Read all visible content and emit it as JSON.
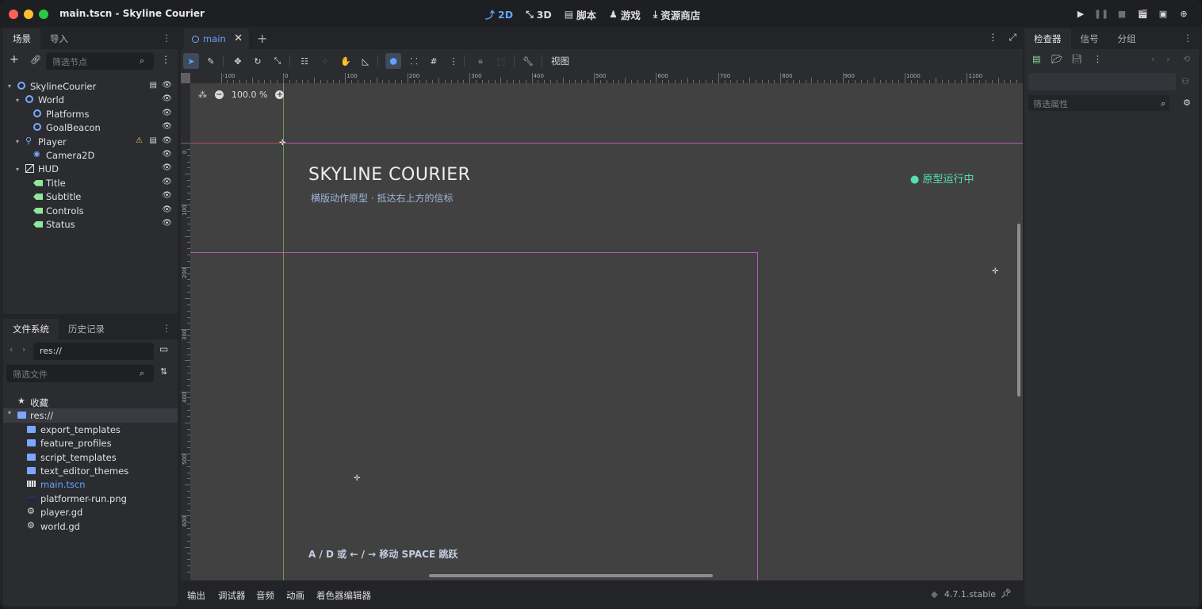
{
  "window": {
    "title": "main.tscn - Skyline Courier"
  },
  "modes": [
    {
      "icon": "2d-icon",
      "label": "2D",
      "active": true
    },
    {
      "icon": "3d-icon",
      "label": "3D",
      "active": false
    },
    {
      "icon": "script-icon",
      "label": "脚本",
      "active": false
    },
    {
      "icon": "game-icon",
      "label": "游戏",
      "active": false
    },
    {
      "icon": "asset-library-icon",
      "label": "资源商店",
      "active": false
    }
  ],
  "scene_dock": {
    "tabs": [
      "场景",
      "导入"
    ],
    "filter_placeholder": "筛选节点",
    "nodes": [
      {
        "label": "SkylineCourier",
        "icon": "node2d-icon",
        "depth": 0,
        "expanded": true,
        "script": true
      },
      {
        "label": "World",
        "icon": "node2d-icon",
        "depth": 1,
        "expanded": true
      },
      {
        "label": "Platforms",
        "icon": "node2d-icon",
        "depth": 2
      },
      {
        "label": "GoalBeacon",
        "icon": "node2d-icon",
        "depth": 2
      },
      {
        "label": "Player",
        "icon": "character-body-icon",
        "depth": 1,
        "expanded": true,
        "script": true,
        "warning": true
      },
      {
        "label": "Camera2D",
        "icon": "camera-icon",
        "depth": 2
      },
      {
        "label": "HUD",
        "icon": "canvas-layer-icon",
        "depth": 1,
        "expanded": true
      },
      {
        "label": "Title",
        "icon": "label-icon",
        "depth": 2
      },
      {
        "label": "Subtitle",
        "icon": "label-icon",
        "depth": 2
      },
      {
        "label": "Controls",
        "icon": "label-icon",
        "depth": 2
      },
      {
        "label": "Status",
        "icon": "label-icon",
        "depth": 2
      }
    ]
  },
  "filesystem_dock": {
    "tabs": [
      "文件系统",
      "历史记录"
    ],
    "path": "res://",
    "filter_placeholder": "筛选文件",
    "favorites_label": "收藏",
    "root_label": "res://",
    "items": [
      {
        "label": "export_templates",
        "icon": "folder-icon"
      },
      {
        "label": "feature_profiles",
        "icon": "folder-icon"
      },
      {
        "label": "script_templates",
        "icon": "folder-icon"
      },
      {
        "label": "text_editor_themes",
        "icon": "folder-icon"
      },
      {
        "label": "main.tscn",
        "icon": "scene-file-icon"
      },
      {
        "label": "platformer-run.png",
        "icon": "image-file-icon"
      },
      {
        "label": "player.gd",
        "icon": "gear-icon"
      },
      {
        "label": "world.gd",
        "icon": "gear-icon"
      }
    ]
  },
  "editor": {
    "tab_label": "main",
    "view_menu": "视图",
    "zoom": "100.0 %",
    "ruler_h": [
      "-100",
      "0",
      "100",
      "200",
      "300",
      "400",
      "500",
      "600",
      "700",
      "800",
      "900",
      "1000",
      "1100"
    ],
    "ruler_v": [
      "0",
      "100",
      "200",
      "300",
      "400",
      "500",
      "600"
    ]
  },
  "game": {
    "title": "SKYLINE COURIER",
    "subtitle": "横版动作原型 · 抵达右上方的信标",
    "status": "● 原型运行中",
    "controls": "A / D 或 ← / → 移动    SPACE 跳跃"
  },
  "bottom_panel": {
    "items": [
      "输出",
      "调试器",
      "音频",
      "动画",
      "着色器编辑器"
    ],
    "version": "4.7.1.stable"
  },
  "inspector": {
    "tabs": [
      "检查器",
      "信号",
      "分组"
    ],
    "filter_placeholder": "筛选属性"
  },
  "colors": {
    "accent": "#62a5ff",
    "status_green": "#55e0b0",
    "axis_x": "#b44a5a",
    "axis_y": "#6f9a54",
    "frame": "#b55ab8"
  }
}
